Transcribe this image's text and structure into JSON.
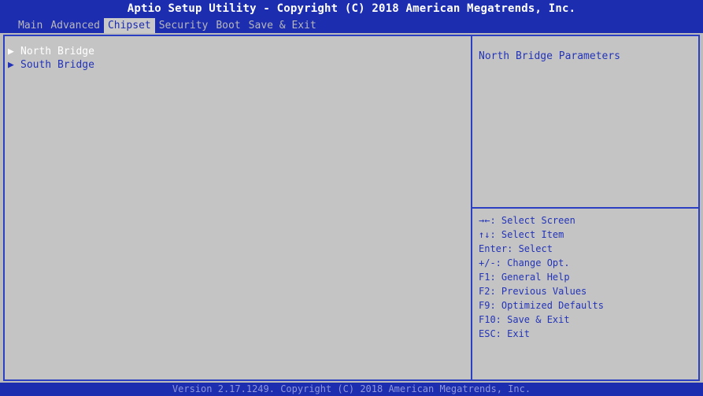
{
  "header": {
    "title": "Aptio Setup Utility - Copyright (C) 2018 American Megatrends, Inc.",
    "tabs": [
      {
        "label": "Main"
      },
      {
        "label": "Advanced"
      },
      {
        "label": "Chipset"
      },
      {
        "label": "Security"
      },
      {
        "label": "Boot"
      },
      {
        "label": "Save & Exit"
      }
    ],
    "active_tab": "Chipset"
  },
  "menu": {
    "items": [
      {
        "label": "North Bridge",
        "selected": true
      },
      {
        "label": "South Bridge",
        "selected": false
      }
    ]
  },
  "help": {
    "text": "North Bridge Parameters"
  },
  "keys": [
    "→←: Select Screen",
    "↑↓: Select Item",
    "Enter: Select",
    "+/-: Change Opt.",
    "F1: General Help",
    "F2: Previous Values",
    "F9: Optimized Defaults",
    "F10: Save & Exit",
    "ESC: Exit"
  ],
  "footer": {
    "text": "Version 2.17.1249. Copyright (C) 2018 American Megatrends, Inc."
  },
  "colors": {
    "bar_blue": "#1c2db0",
    "panel_gray": "#c4c4c4",
    "text_blue": "#2334b8"
  }
}
